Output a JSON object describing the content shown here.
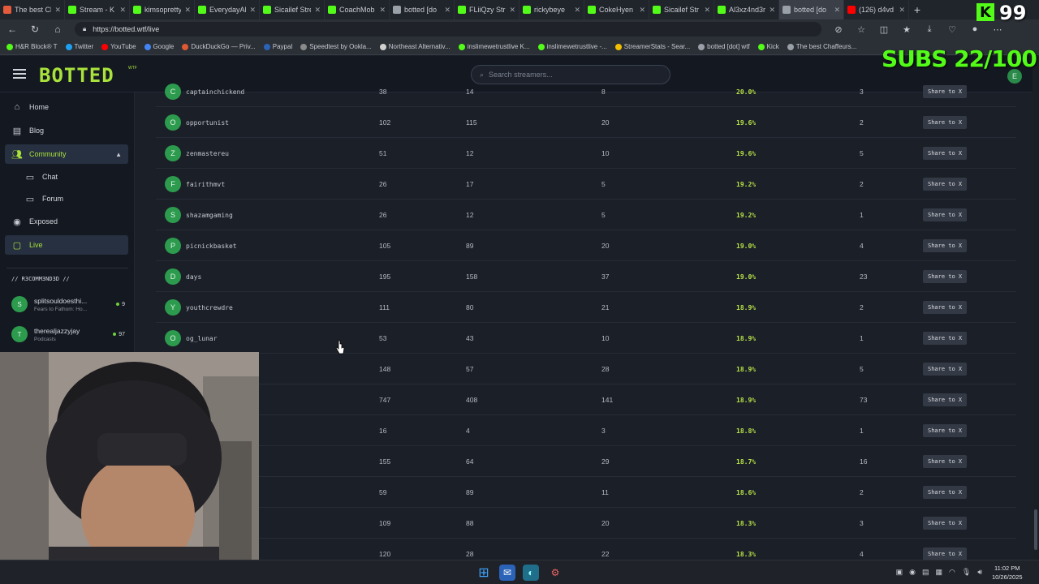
{
  "browser": {
    "tabs": [
      {
        "label": "The best Cl",
        "color": "#e45b3c"
      },
      {
        "label": "Stream - K",
        "color": "#53fc18"
      },
      {
        "label": "kimsopretty",
        "color": "#53fc18"
      },
      {
        "label": "EverydayAl",
        "color": "#53fc18"
      },
      {
        "label": "Sicailef Stre",
        "color": "#53fc18"
      },
      {
        "label": "CoachMob",
        "color": "#53fc18"
      },
      {
        "label": "botted [do",
        "color": "#9aa0a8"
      },
      {
        "label": "FLiiQzy Str",
        "color": "#53fc18"
      },
      {
        "label": "rickybeye",
        "color": "#53fc18"
      },
      {
        "label": "CokeHyen",
        "color": "#53fc18"
      },
      {
        "label": "Sicailef Str",
        "color": "#53fc18"
      },
      {
        "label": "Al3xz4nd3r",
        "color": "#53fc18"
      },
      {
        "label": "botted [do",
        "color": "#9aa0a8",
        "active": true
      },
      {
        "label": "(126) d4vd",
        "color": "#ff0000"
      }
    ],
    "url": "https://botted.wtf/live",
    "bookmarks": [
      "H&R Block® T",
      "Twitter",
      "YouTube",
      "Google",
      "DuckDuckGo — Priv...",
      "Paypal",
      "Speedtest by Ookla...",
      "Northeast Alternativ...",
      "inslimewetrustlive K...",
      "inslimewetrustlive -...",
      "StreamerStats - Sear...",
      "botted [dot] wtf",
      "Kick",
      "The best Chaffeurs..."
    ]
  },
  "site": {
    "logo": "BOTTED",
    "logo_sup": "WTF",
    "search_placeholder": "Search streamers...",
    "user_initial": "E"
  },
  "sidebar": {
    "items": [
      {
        "label": "Home",
        "icon": "home-icon"
      },
      {
        "label": "Blog",
        "icon": "blog-icon"
      },
      {
        "label": "Community",
        "icon": "community-icon"
      },
      {
        "label": "Chat",
        "icon": "chat-icon"
      },
      {
        "label": "Forum",
        "icon": "forum-icon"
      },
      {
        "label": "Exposed",
        "icon": "eye-icon"
      },
      {
        "label": "Live",
        "icon": "tv-icon"
      }
    ],
    "rec_heading": "// R3COMM3ND3D //",
    "recommended": [
      {
        "initial": "S",
        "name": "splitsouldoesthi...",
        "category": "Fears to Fathom: Ho...",
        "viewers": "9"
      },
      {
        "initial": "T",
        "name": "therealjazzyjay",
        "category": "Podcasts",
        "viewers": "97"
      }
    ]
  },
  "table": {
    "share_label": "Share to X",
    "partial_top": {
      "initial": "C",
      "name": "captainchickend",
      "c1": "38",
      "c2": "14",
      "c3": "8",
      "pct": "20.0%",
      "c5": "3"
    },
    "rows": [
      {
        "initial": "O",
        "name": "opportunist",
        "c1": "102",
        "c2": "115",
        "c3": "20",
        "pct": "19.6%",
        "c5": "2"
      },
      {
        "initial": "Z",
        "name": "zenmastereu",
        "c1": "51",
        "c2": "12",
        "c3": "10",
        "pct": "19.6%",
        "c5": "5"
      },
      {
        "initial": "F",
        "name": "fairithmvt",
        "c1": "26",
        "c2": "17",
        "c3": "5",
        "pct": "19.2%",
        "c5": "2"
      },
      {
        "initial": "S",
        "name": "shazamgaming",
        "c1": "26",
        "c2": "12",
        "c3": "5",
        "pct": "19.2%",
        "c5": "1"
      },
      {
        "initial": "P",
        "name": "picnickbasket",
        "c1": "105",
        "c2": "89",
        "c3": "20",
        "pct": "19.0%",
        "c5": "4"
      },
      {
        "initial": "D",
        "name": "days",
        "c1": "195",
        "c2": "158",
        "c3": "37",
        "pct": "19.0%",
        "c5": "23"
      },
      {
        "initial": "Y",
        "name": "youthcrewdre",
        "c1": "111",
        "c2": "80",
        "c3": "21",
        "pct": "18.9%",
        "c5": "2"
      },
      {
        "initial": "O",
        "name": "og_lunar",
        "c1": "53",
        "c2": "43",
        "c3": "10",
        "pct": "18.9%",
        "c5": "1"
      },
      {
        "initial": "",
        "name": "",
        "c1": "148",
        "c2": "57",
        "c3": "28",
        "pct": "18.9%",
        "c5": "5"
      },
      {
        "initial": "",
        "name": "",
        "c1": "747",
        "c2": "408",
        "c3": "141",
        "pct": "18.9%",
        "c5": "73"
      },
      {
        "initial": "",
        "name": "",
        "c1": "16",
        "c2": "4",
        "c3": "3",
        "pct": "18.8%",
        "c5": "1"
      },
      {
        "initial": "",
        "name": "",
        "c1": "155",
        "c2": "64",
        "c3": "29",
        "pct": "18.7%",
        "c5": "16"
      },
      {
        "initial": "",
        "name": "",
        "c1": "59",
        "c2": "89",
        "c3": "11",
        "pct": "18.6%",
        "c5": "2"
      },
      {
        "initial": "",
        "name": "",
        "c1": "109",
        "c2": "88",
        "c3": "20",
        "pct": "18.3%",
        "c5": "3"
      },
      {
        "initial": "",
        "name": "",
        "c1": "120",
        "c2": "28",
        "c3": "22",
        "pct": "18.3%",
        "c5": "4"
      }
    ]
  },
  "overlay": {
    "kick_letter": "K",
    "kick_count": "99",
    "subs_goal": "SUBS 22/100"
  },
  "taskbar": {
    "time": "11:02 PM",
    "date": "10/26/2025"
  },
  "colors": {
    "accent": "#a9e23b",
    "kick_green": "#53fc18"
  }
}
